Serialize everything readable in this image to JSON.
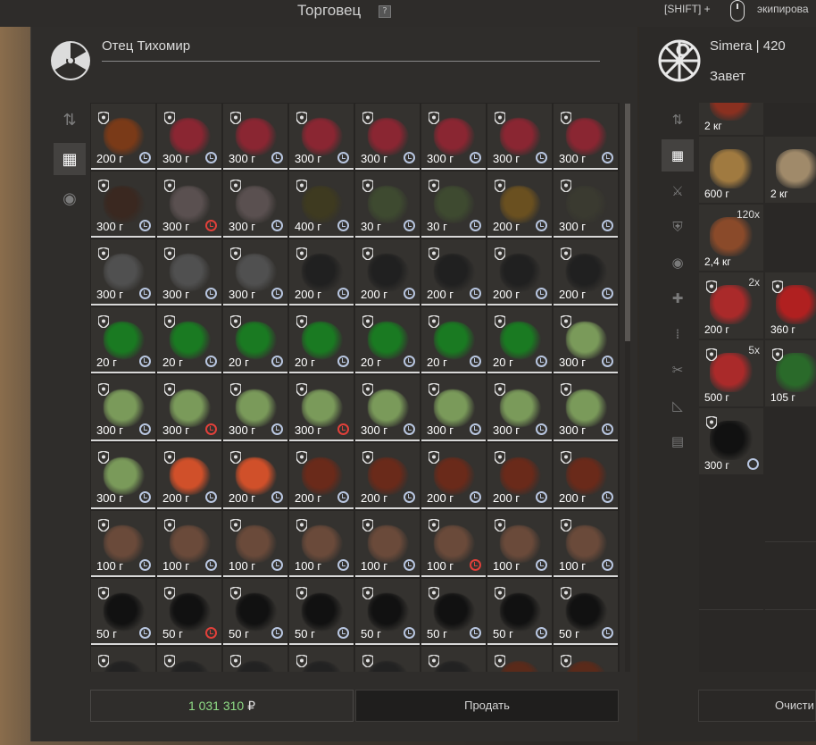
{
  "header": {
    "title": "Торговец",
    "help": "?",
    "hint_key": "[SHIFT] +",
    "hint_action": "экипирова"
  },
  "trader": {
    "name": "Отец Тихомир",
    "icon": "radiation-icon"
  },
  "player": {
    "name": "Simera | 420",
    "faction": "Завет",
    "icon": "faction-emblem-icon"
  },
  "left_tabs": [
    "sort-icon",
    "grid-icon",
    "artifact-icon"
  ],
  "right_tabs": [
    "sort-icon",
    "grid-icon",
    "weapon-icon",
    "armor-icon",
    "artifact-icon",
    "medkit-icon",
    "ammo-icon",
    "tools-icon",
    "ruler-icon",
    "storage-icon"
  ],
  "colors": {
    "money": "#8fdc86",
    "clock_normal": "#b8c6e0",
    "clock_warn": "#e0403a"
  },
  "inventory_rows": [
    [
      {
        "w": "200 г",
        "c": "n",
        "k": "#7a3a18"
      },
      {
        "w": "300 г",
        "c": "n",
        "k": "#8a2632"
      },
      {
        "w": "300 г",
        "c": "n",
        "k": "#8a2632"
      },
      {
        "w": "300 г",
        "c": "n",
        "k": "#8a2632"
      },
      {
        "w": "300 г",
        "c": "n",
        "k": "#8a2632"
      },
      {
        "w": "300 г",
        "c": "n",
        "k": "#8a2632"
      },
      {
        "w": "300 г",
        "c": "n",
        "k": "#8a2632"
      },
      {
        "w": "300 г",
        "c": "n",
        "k": "#8a2632"
      }
    ],
    [
      {
        "w": "300 г",
        "c": "n",
        "k": "#3a2820"
      },
      {
        "w": "300 г",
        "c": "r",
        "k": "#5a5050"
      },
      {
        "w": "300 г",
        "c": "n",
        "k": "#5a5050"
      },
      {
        "w": "400 г",
        "c": "n",
        "k": "#3e3a20"
      },
      {
        "w": "30 г",
        "c": "n",
        "k": "#3e4a30"
      },
      {
        "w": "30 г",
        "c": "n",
        "k": "#3e4a30"
      },
      {
        "w": "200 г",
        "c": "n",
        "k": "#6a5020"
      },
      {
        "w": "300 г",
        "c": "n",
        "k": "#3a3a30"
      }
    ],
    [
      {
        "w": "300 г",
        "c": "n",
        "k": "#505050"
      },
      {
        "w": "300 г",
        "c": "n",
        "k": "#505050"
      },
      {
        "w": "300 г",
        "c": "n",
        "k": "#505050"
      },
      {
        "w": "200 г",
        "c": "n",
        "k": "#202020"
      },
      {
        "w": "200 г",
        "c": "n",
        "k": "#202020"
      },
      {
        "w": "200 г",
        "c": "n",
        "k": "#202020"
      },
      {
        "w": "200 г",
        "c": "n",
        "k": "#202020"
      },
      {
        "w": "200 г",
        "c": "n",
        "k": "#202020"
      }
    ],
    [
      {
        "w": "20 г",
        "c": "n",
        "k": "#1a7a22"
      },
      {
        "w": "20 г",
        "c": "n",
        "k": "#1a7a22"
      },
      {
        "w": "20 г",
        "c": "n",
        "k": "#1a7a22"
      },
      {
        "w": "20 г",
        "c": "n",
        "k": "#1a7a22"
      },
      {
        "w": "20 г",
        "c": "n",
        "k": "#1a7a22"
      },
      {
        "w": "20 г",
        "c": "n",
        "k": "#1a7a22"
      },
      {
        "w": "20 г",
        "c": "n",
        "k": "#1a7a22"
      },
      {
        "w": "300 г",
        "c": "n",
        "k": "#7a9a5a"
      }
    ],
    [
      {
        "w": "300 г",
        "c": "n",
        "k": "#7a9a5a"
      },
      {
        "w": "300 г",
        "c": "r",
        "k": "#7a9a5a"
      },
      {
        "w": "300 г",
        "c": "n",
        "k": "#7a9a5a"
      },
      {
        "w": "300 г",
        "c": "r",
        "k": "#7a9a5a"
      },
      {
        "w": "300 г",
        "c": "n",
        "k": "#7a9a5a"
      },
      {
        "w": "300 г",
        "c": "n",
        "k": "#7a9a5a"
      },
      {
        "w": "300 г",
        "c": "n",
        "k": "#7a9a5a"
      },
      {
        "w": "300 г",
        "c": "n",
        "k": "#7a9a5a"
      }
    ],
    [
      {
        "w": "300 г",
        "c": "n",
        "k": "#7a9a5a"
      },
      {
        "w": "200 г",
        "c": "n",
        "k": "#d0502a"
      },
      {
        "w": "200 г",
        "c": "n",
        "k": "#d0502a"
      },
      {
        "w": "200 г",
        "c": "n",
        "k": "#6a2a1a"
      },
      {
        "w": "200 г",
        "c": "n",
        "k": "#6a2a1a"
      },
      {
        "w": "200 г",
        "c": "n",
        "k": "#6a2a1a"
      },
      {
        "w": "200 г",
        "c": "n",
        "k": "#6a2a1a"
      },
      {
        "w": "200 г",
        "c": "n",
        "k": "#6a2a1a"
      }
    ],
    [
      {
        "w": "100 г",
        "c": "n",
        "k": "#6a4a3a"
      },
      {
        "w": "100 г",
        "c": "n",
        "k": "#6a4a3a"
      },
      {
        "w": "100 г",
        "c": "n",
        "k": "#6a4a3a"
      },
      {
        "w": "100 г",
        "c": "n",
        "k": "#6a4a3a"
      },
      {
        "w": "100 г",
        "c": "n",
        "k": "#6a4a3a"
      },
      {
        "w": "100 г",
        "c": "r",
        "k": "#6a4a3a"
      },
      {
        "w": "100 г",
        "c": "n",
        "k": "#6a4a3a"
      },
      {
        "w": "100 г",
        "c": "n",
        "k": "#6a4a3a"
      }
    ],
    [
      {
        "w": "50 г",
        "c": "n",
        "k": "#111111"
      },
      {
        "w": "50 г",
        "c": "r",
        "k": "#111111"
      },
      {
        "w": "50 г",
        "c": "n",
        "k": "#111111"
      },
      {
        "w": "50 г",
        "c": "n",
        "k": "#111111"
      },
      {
        "w": "50 г",
        "c": "n",
        "k": "#111111"
      },
      {
        "w": "50 г",
        "c": "n",
        "k": "#111111"
      },
      {
        "w": "50 г",
        "c": "n",
        "k": "#111111"
      },
      {
        "w": "50 г",
        "c": "n",
        "k": "#111111"
      }
    ],
    [
      {
        "w": "",
        "c": "",
        "k": "#222"
      },
      {
        "w": "",
        "c": "",
        "k": "#222"
      },
      {
        "w": "",
        "c": "",
        "k": "#222"
      },
      {
        "w": "",
        "c": "",
        "k": "#222"
      },
      {
        "w": "",
        "c": "",
        "k": "#222"
      },
      {
        "w": "",
        "c": "",
        "k": "#222"
      },
      {
        "w": "",
        "c": "",
        "k": "#5a2a1a"
      },
      {
        "w": "",
        "c": "",
        "k": "#5a2a1a"
      }
    ]
  ],
  "right_items": [
    {
      "w": "2 кг",
      "count": "",
      "k": "#8a3020",
      "shield": false,
      "clock": false
    },
    {
      "w": "",
      "count": "",
      "k": "",
      "shield": false,
      "clock": false
    },
    {
      "w": "600 г",
      "count": "",
      "k": "#a07a40",
      "shield": false,
      "clock": false
    },
    {
      "w": "2 кг",
      "count": "",
      "k": "#a08a6a",
      "shield": false,
      "clock": false
    },
    {
      "w": "2,4 кг",
      "count": "120x",
      "k": "#8a4a2a",
      "shield": false,
      "clock": false
    },
    {
      "w": "",
      "count": "",
      "k": "",
      "shield": false,
      "clock": false
    },
    {
      "w": "200 г",
      "count": "2x",
      "k": "#aa2a2a",
      "shield": true,
      "clock": false
    },
    {
      "w": "360 г",
      "count": "",
      "k": "#b02020",
      "shield": true,
      "clock": false
    },
    {
      "w": "500 г",
      "count": "5x",
      "k": "#aa2a2a",
      "shield": true,
      "clock": false
    },
    {
      "w": "105 г",
      "count": "",
      "k": "#2a6a2a",
      "shield": true,
      "clock": false
    },
    {
      "w": "300 г",
      "count": "",
      "k": "#111111",
      "shield": true,
      "clock": true
    }
  ],
  "footer": {
    "money": "1 031 310",
    "currency": "₽",
    "sell_label": "Продать",
    "clear_label": "Очисти"
  }
}
